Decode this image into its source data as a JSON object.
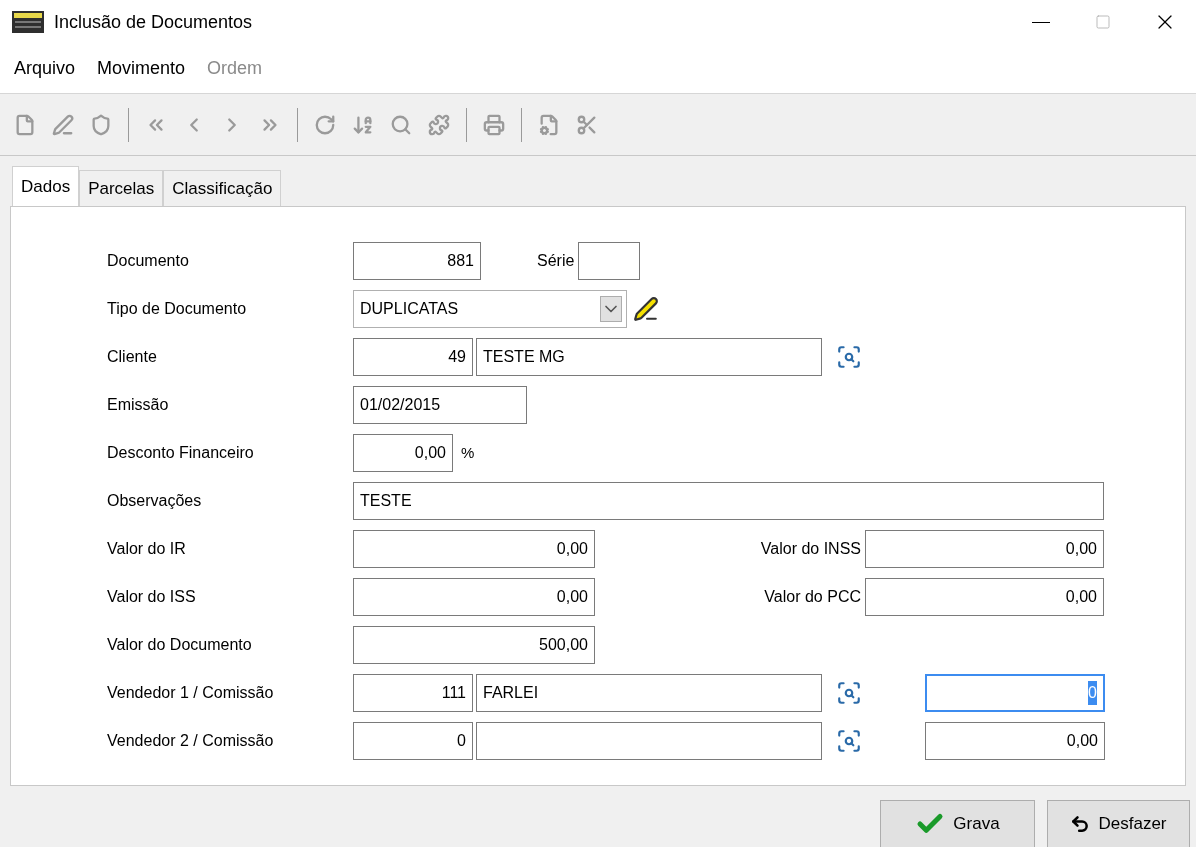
{
  "window": {
    "title": "Inclusão de Documentos"
  },
  "menu": [
    {
      "label": "Arquivo",
      "disabled": false
    },
    {
      "label": "Movimento",
      "disabled": false
    },
    {
      "label": "Ordem",
      "disabled": true
    }
  ],
  "tabs": [
    {
      "label": "Dados",
      "selected": true
    },
    {
      "label": "Parcelas",
      "selected": false
    },
    {
      "label": "Classificação",
      "selected": false
    }
  ],
  "rows": [
    {
      "kind": "document",
      "label": "Documento",
      "value": "881",
      "serie_label": "Série"
    },
    {
      "kind": "select",
      "label": "Tipo de Documento",
      "value": "DUPLICATAS"
    },
    {
      "kind": "lookup",
      "label": "Cliente",
      "code": "49",
      "name": "TESTE MG"
    },
    {
      "kind": "date",
      "label": "Emissão",
      "value": "01/02/2015"
    },
    {
      "kind": "percent",
      "label": "Desconto Financeiro",
      "value": "0,00",
      "suffix": "%"
    },
    {
      "kind": "text",
      "label": "Observações",
      "value": "TESTE"
    },
    {
      "kind": "pair",
      "label": "Valor do IR",
      "value": "0,00",
      "right_label": "Valor do INSS",
      "right_value": "0,00"
    },
    {
      "kind": "pair",
      "label": "Valor do ISS",
      "value": "0,00",
      "right_label": "Valor do PCC",
      "right_value": "0,00"
    },
    {
      "kind": "amount",
      "label": "Valor do Documento",
      "value": "500,00"
    },
    {
      "kind": "seller",
      "label": "Vendedor 1 / Comissão",
      "code": "111",
      "name": "FARLEI",
      "commission": "0",
      "focused": true
    },
    {
      "kind": "seller",
      "label": "Vendedor 2 / Comissão",
      "code": "0",
      "commission": "0,00",
      "focused": false
    }
  ],
  "buttons": [
    {
      "kind": "save",
      "label": "Grava"
    },
    {
      "kind": "undo",
      "label": "Desfazer"
    }
  ]
}
